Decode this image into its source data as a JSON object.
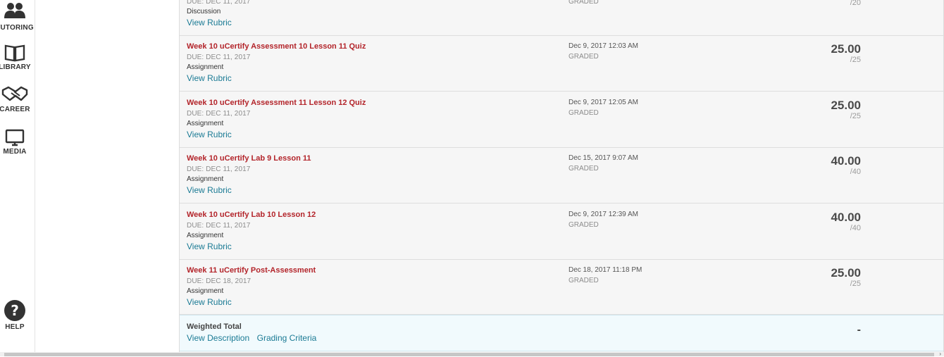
{
  "rail": {
    "tutoring": {
      "label": "TUTORING",
      "icon": "people-icon"
    },
    "library": {
      "label": "LIBRARY",
      "icon": "book-icon"
    },
    "career": {
      "label": "CAREER",
      "icon": "handshake-icon"
    },
    "media": {
      "label": "MEDIA",
      "icon": "tv-icon"
    },
    "help": {
      "label": "HELP",
      "icon": "question-circle-icon"
    }
  },
  "rows": [
    {
      "title": "",
      "due": "DUE: DEC 11, 2017",
      "type": "Discussion",
      "rubric_link": "View Rubric",
      "date": "",
      "status": "GRADED",
      "score": "",
      "possible": "/20"
    },
    {
      "title": "Week 10 uCertify Assessment 10 Lesson 11 Quiz",
      "due": "DUE: DEC 11, 2017",
      "type": "Assignment",
      "rubric_link": "View Rubric",
      "date": "Dec 9, 2017 12:03 AM",
      "status": "GRADED",
      "score": "25.00",
      "possible": "/25"
    },
    {
      "title": "Week 10 uCertify Assessment 11 Lesson 12 Quiz",
      "due": "DUE: DEC 11, 2017",
      "type": "Assignment",
      "rubric_link": "View Rubric",
      "date": "Dec 9, 2017 12:05 AM",
      "status": "GRADED",
      "score": "25.00",
      "possible": "/25"
    },
    {
      "title": "Week 10 uCertify Lab 9 Lesson 11",
      "due": "DUE: DEC 11, 2017",
      "type": "Assignment",
      "rubric_link": "View Rubric",
      "date": "Dec 15, 2017 9:07 AM",
      "status": "GRADED",
      "score": "40.00",
      "possible": "/40"
    },
    {
      "title": "Week 10 uCertify Lab 10 Lesson 12",
      "due": "DUE: DEC 11, 2017",
      "type": "Assignment",
      "rubric_link": "View Rubric",
      "date": "Dec 9, 2017 12:39 AM",
      "status": "GRADED",
      "score": "40.00",
      "possible": "/40"
    },
    {
      "title": "Week 11 uCertify Post-Assessment",
      "due": "DUE: DEC 18, 2017",
      "type": "Assignment",
      "rubric_link": "View Rubric",
      "date": "Dec 18, 2017 11:18 PM",
      "status": "GRADED",
      "score": "25.00",
      "possible": "/25"
    }
  ],
  "weighted_total": {
    "label": "Weighted Total",
    "description_link": "View Description",
    "criteria_link": "Grading Criteria",
    "value": "-"
  },
  "colors": {
    "title_red": "#b3242a",
    "link_teal": "#1a7a94",
    "total_bg": "#f1fafd"
  }
}
